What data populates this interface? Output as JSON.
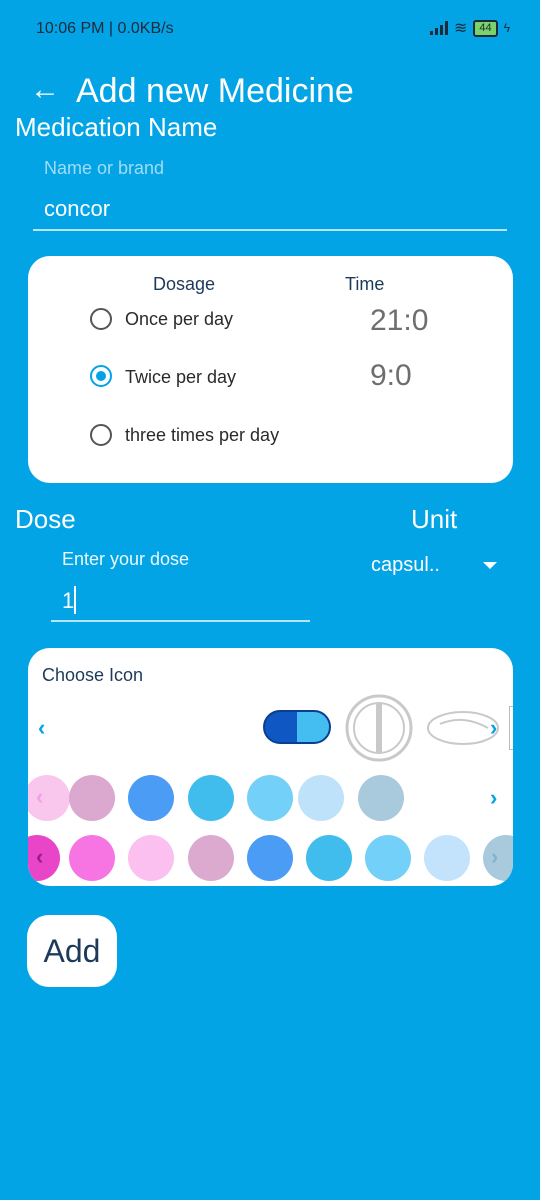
{
  "status_bar": {
    "time": "10:06 PM | 0.0KB/s",
    "battery": "44"
  },
  "header": {
    "title": "Add new Medicine",
    "back_icon": "arrow-left-icon"
  },
  "medication": {
    "label": "Medication Name",
    "placeholder": "Name or brand",
    "value": "concor"
  },
  "dosage_card": {
    "dosage_header": "Dosage",
    "time_header": "Time",
    "options": [
      {
        "label": "Once per day",
        "selected": false
      },
      {
        "label": "Twice per day",
        "selected": true
      },
      {
        "label": "three times per day",
        "selected": false
      }
    ],
    "times": [
      "21:0",
      "9:0"
    ]
  },
  "dose": {
    "label": "Dose",
    "placeholder": "Enter your dose",
    "value": "1"
  },
  "unit": {
    "label": "Unit",
    "selected": "capsul.."
  },
  "icon_card": {
    "label": "Choose Icon",
    "icons": [
      "capsule-icon",
      "round-tablet-icon",
      "oval-tablet-icon"
    ],
    "colors_row1": [
      "#f9c6ee",
      "#dba8cf",
      "#4b9cf5",
      "#40bdec",
      "#73d0f8",
      "#bfe2fb",
      "#a9c9dc"
    ],
    "colors_row2": [
      "#e845c8",
      "#f775e2",
      "#fbbff0",
      "#dca9cf",
      "#4b9cf5",
      "#40bdec",
      "#73d0f8",
      "#c2e3fb",
      "#a9c9dc"
    ]
  },
  "add_button": {
    "label": "Add"
  }
}
